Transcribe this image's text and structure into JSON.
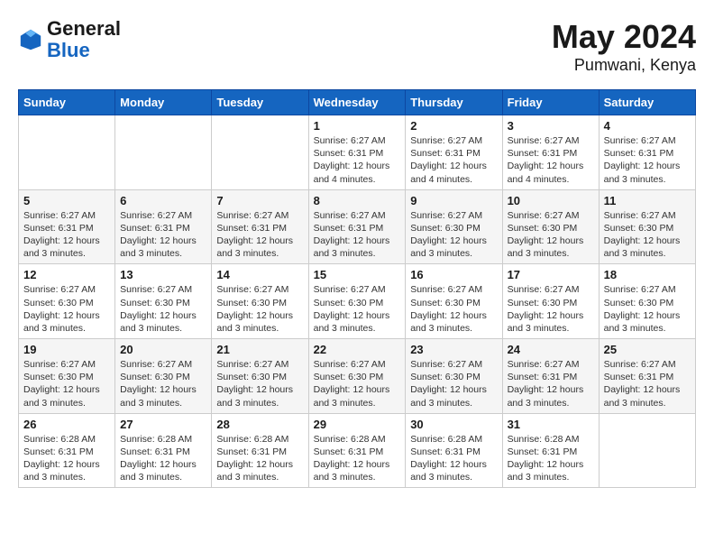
{
  "logo": {
    "line1": "General",
    "line2": "Blue"
  },
  "title": {
    "month": "May 2024",
    "location": "Pumwani, Kenya"
  },
  "weekdays": [
    "Sunday",
    "Monday",
    "Tuesday",
    "Wednesday",
    "Thursday",
    "Friday",
    "Saturday"
  ],
  "weeks": [
    [
      {
        "day": null,
        "info": null
      },
      {
        "day": null,
        "info": null
      },
      {
        "day": null,
        "info": null
      },
      {
        "day": "1",
        "info": "Sunrise: 6:27 AM\nSunset: 6:31 PM\nDaylight: 12 hours\nand 4 minutes."
      },
      {
        "day": "2",
        "info": "Sunrise: 6:27 AM\nSunset: 6:31 PM\nDaylight: 12 hours\nand 4 minutes."
      },
      {
        "day": "3",
        "info": "Sunrise: 6:27 AM\nSunset: 6:31 PM\nDaylight: 12 hours\nand 4 minutes."
      },
      {
        "day": "4",
        "info": "Sunrise: 6:27 AM\nSunset: 6:31 PM\nDaylight: 12 hours\nand 3 minutes."
      }
    ],
    [
      {
        "day": "5",
        "info": "Sunrise: 6:27 AM\nSunset: 6:31 PM\nDaylight: 12 hours\nand 3 minutes."
      },
      {
        "day": "6",
        "info": "Sunrise: 6:27 AM\nSunset: 6:31 PM\nDaylight: 12 hours\nand 3 minutes."
      },
      {
        "day": "7",
        "info": "Sunrise: 6:27 AM\nSunset: 6:31 PM\nDaylight: 12 hours\nand 3 minutes."
      },
      {
        "day": "8",
        "info": "Sunrise: 6:27 AM\nSunset: 6:31 PM\nDaylight: 12 hours\nand 3 minutes."
      },
      {
        "day": "9",
        "info": "Sunrise: 6:27 AM\nSunset: 6:30 PM\nDaylight: 12 hours\nand 3 minutes."
      },
      {
        "day": "10",
        "info": "Sunrise: 6:27 AM\nSunset: 6:30 PM\nDaylight: 12 hours\nand 3 minutes."
      },
      {
        "day": "11",
        "info": "Sunrise: 6:27 AM\nSunset: 6:30 PM\nDaylight: 12 hours\nand 3 minutes."
      }
    ],
    [
      {
        "day": "12",
        "info": "Sunrise: 6:27 AM\nSunset: 6:30 PM\nDaylight: 12 hours\nand 3 minutes."
      },
      {
        "day": "13",
        "info": "Sunrise: 6:27 AM\nSunset: 6:30 PM\nDaylight: 12 hours\nand 3 minutes."
      },
      {
        "day": "14",
        "info": "Sunrise: 6:27 AM\nSunset: 6:30 PM\nDaylight: 12 hours\nand 3 minutes."
      },
      {
        "day": "15",
        "info": "Sunrise: 6:27 AM\nSunset: 6:30 PM\nDaylight: 12 hours\nand 3 minutes."
      },
      {
        "day": "16",
        "info": "Sunrise: 6:27 AM\nSunset: 6:30 PM\nDaylight: 12 hours\nand 3 minutes."
      },
      {
        "day": "17",
        "info": "Sunrise: 6:27 AM\nSunset: 6:30 PM\nDaylight: 12 hours\nand 3 minutes."
      },
      {
        "day": "18",
        "info": "Sunrise: 6:27 AM\nSunset: 6:30 PM\nDaylight: 12 hours\nand 3 minutes."
      }
    ],
    [
      {
        "day": "19",
        "info": "Sunrise: 6:27 AM\nSunset: 6:30 PM\nDaylight: 12 hours\nand 3 minutes."
      },
      {
        "day": "20",
        "info": "Sunrise: 6:27 AM\nSunset: 6:30 PM\nDaylight: 12 hours\nand 3 minutes."
      },
      {
        "day": "21",
        "info": "Sunrise: 6:27 AM\nSunset: 6:30 PM\nDaylight: 12 hours\nand 3 minutes."
      },
      {
        "day": "22",
        "info": "Sunrise: 6:27 AM\nSunset: 6:30 PM\nDaylight: 12 hours\nand 3 minutes."
      },
      {
        "day": "23",
        "info": "Sunrise: 6:27 AM\nSunset: 6:30 PM\nDaylight: 12 hours\nand 3 minutes."
      },
      {
        "day": "24",
        "info": "Sunrise: 6:27 AM\nSunset: 6:31 PM\nDaylight: 12 hours\nand 3 minutes."
      },
      {
        "day": "25",
        "info": "Sunrise: 6:27 AM\nSunset: 6:31 PM\nDaylight: 12 hours\nand 3 minutes."
      }
    ],
    [
      {
        "day": "26",
        "info": "Sunrise: 6:28 AM\nSunset: 6:31 PM\nDaylight: 12 hours\nand 3 minutes."
      },
      {
        "day": "27",
        "info": "Sunrise: 6:28 AM\nSunset: 6:31 PM\nDaylight: 12 hours\nand 3 minutes."
      },
      {
        "day": "28",
        "info": "Sunrise: 6:28 AM\nSunset: 6:31 PM\nDaylight: 12 hours\nand 3 minutes."
      },
      {
        "day": "29",
        "info": "Sunrise: 6:28 AM\nSunset: 6:31 PM\nDaylight: 12 hours\nand 3 minutes."
      },
      {
        "day": "30",
        "info": "Sunrise: 6:28 AM\nSunset: 6:31 PM\nDaylight: 12 hours\nand 3 minutes."
      },
      {
        "day": "31",
        "info": "Sunrise: 6:28 AM\nSunset: 6:31 PM\nDaylight: 12 hours\nand 3 minutes."
      },
      {
        "day": null,
        "info": null
      }
    ]
  ]
}
